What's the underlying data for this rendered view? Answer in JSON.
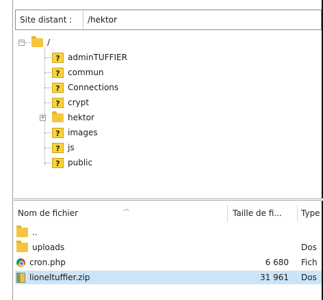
{
  "remote_site": {
    "label": "Site distant :",
    "path": "/hektor"
  },
  "tree": {
    "root": "/",
    "items": [
      {
        "label": "adminTUFFIER",
        "icon": "unknown-folder-icon"
      },
      {
        "label": "commun",
        "icon": "unknown-folder-icon"
      },
      {
        "label": "Connections",
        "icon": "unknown-folder-icon"
      },
      {
        "label": "crypt",
        "icon": "unknown-folder-icon"
      },
      {
        "label": "hektor",
        "icon": "folder-icon",
        "expandable": true
      },
      {
        "label": "images",
        "icon": "unknown-folder-icon"
      },
      {
        "label": "js",
        "icon": "unknown-folder-icon"
      },
      {
        "label": "public",
        "icon": "unknown-folder-icon"
      }
    ]
  },
  "filelist": {
    "columns": {
      "name": "Nom de fichier",
      "size": "Taille de fi...",
      "type": "Type"
    },
    "rows": [
      {
        "name": "..",
        "size": "",
        "type": "",
        "icon": "folder-icon"
      },
      {
        "name": "uploads",
        "size": "",
        "type": "Dos",
        "icon": "folder-icon"
      },
      {
        "name": "cron.php",
        "size": "6 680",
        "type": "Fich",
        "icon": "chrome-icon"
      },
      {
        "name": "lioneltuffier.zip",
        "size": "31 961",
        "type": "Dos",
        "icon": "archive-icon",
        "selected": true
      }
    ]
  }
}
